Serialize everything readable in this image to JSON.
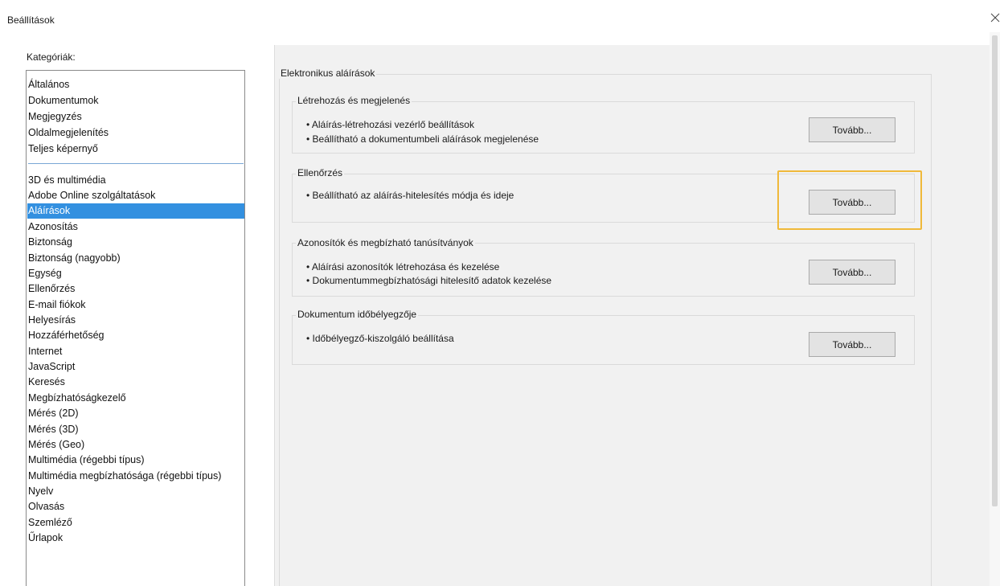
{
  "window": {
    "title": "Beállítások",
    "close_label": "✕"
  },
  "categories": {
    "label": "Kategóriák:",
    "group1": [
      "Általános",
      "Dokumentumok",
      "Megjegyzés",
      "Oldalmegjelenítés",
      "Teljes képernyő"
    ],
    "group2": [
      "3D és multimédia",
      "Adobe Online szolgáltatások",
      "Aláírások",
      "Azonosítás",
      "Biztonság",
      "Biztonság (nagyobb)",
      "Egység",
      "Ellenőrzés",
      "E-mail fiókok",
      "Helyesírás",
      "Hozzáférhetőség",
      "Internet",
      "JavaScript",
      "Keresés",
      "Megbízhatóságkezelő",
      "Mérés (2D)",
      "Mérés (3D)",
      "Mérés (Geo)",
      "Multimédia (régebbi típus)",
      "Multimédia megbízhatósága (régebbi típus)",
      "Nyelv",
      "Olvasás",
      "Szemléző",
      "Űrlapok"
    ],
    "selected": "Aláírások"
  },
  "main": {
    "title": "Elektronikus aláírások",
    "sections": [
      {
        "title": "Létrehozás és megjelenés",
        "bullets": [
          "• Aláírás-létrehozási vezérlő beállítások",
          "• Beállítható a dokumentumbeli aláírások megjelenése"
        ],
        "button": "Tovább..."
      },
      {
        "title": "Ellenőrzés",
        "bullets": [
          "• Beállítható az aláírás-hitelesítés módja és ideje"
        ],
        "button": "Tovább..."
      },
      {
        "title": "Azonosítók és megbízható tanúsítványok",
        "bullets": [
          "• Aláírási azonosítók létrehozása és kezelése",
          "• Dokumentummegbízhatósági hitelesítő adatok kezelése"
        ],
        "button": "Tovább..."
      },
      {
        "title": "Dokumentum időbélyegzője",
        "bullets": [
          "• Időbélyegző-kiszolgáló beállítása"
        ],
        "button": "Tovább..."
      }
    ]
  },
  "colors": {
    "selection": "#3390e0",
    "highlight": "#f0b93a"
  }
}
